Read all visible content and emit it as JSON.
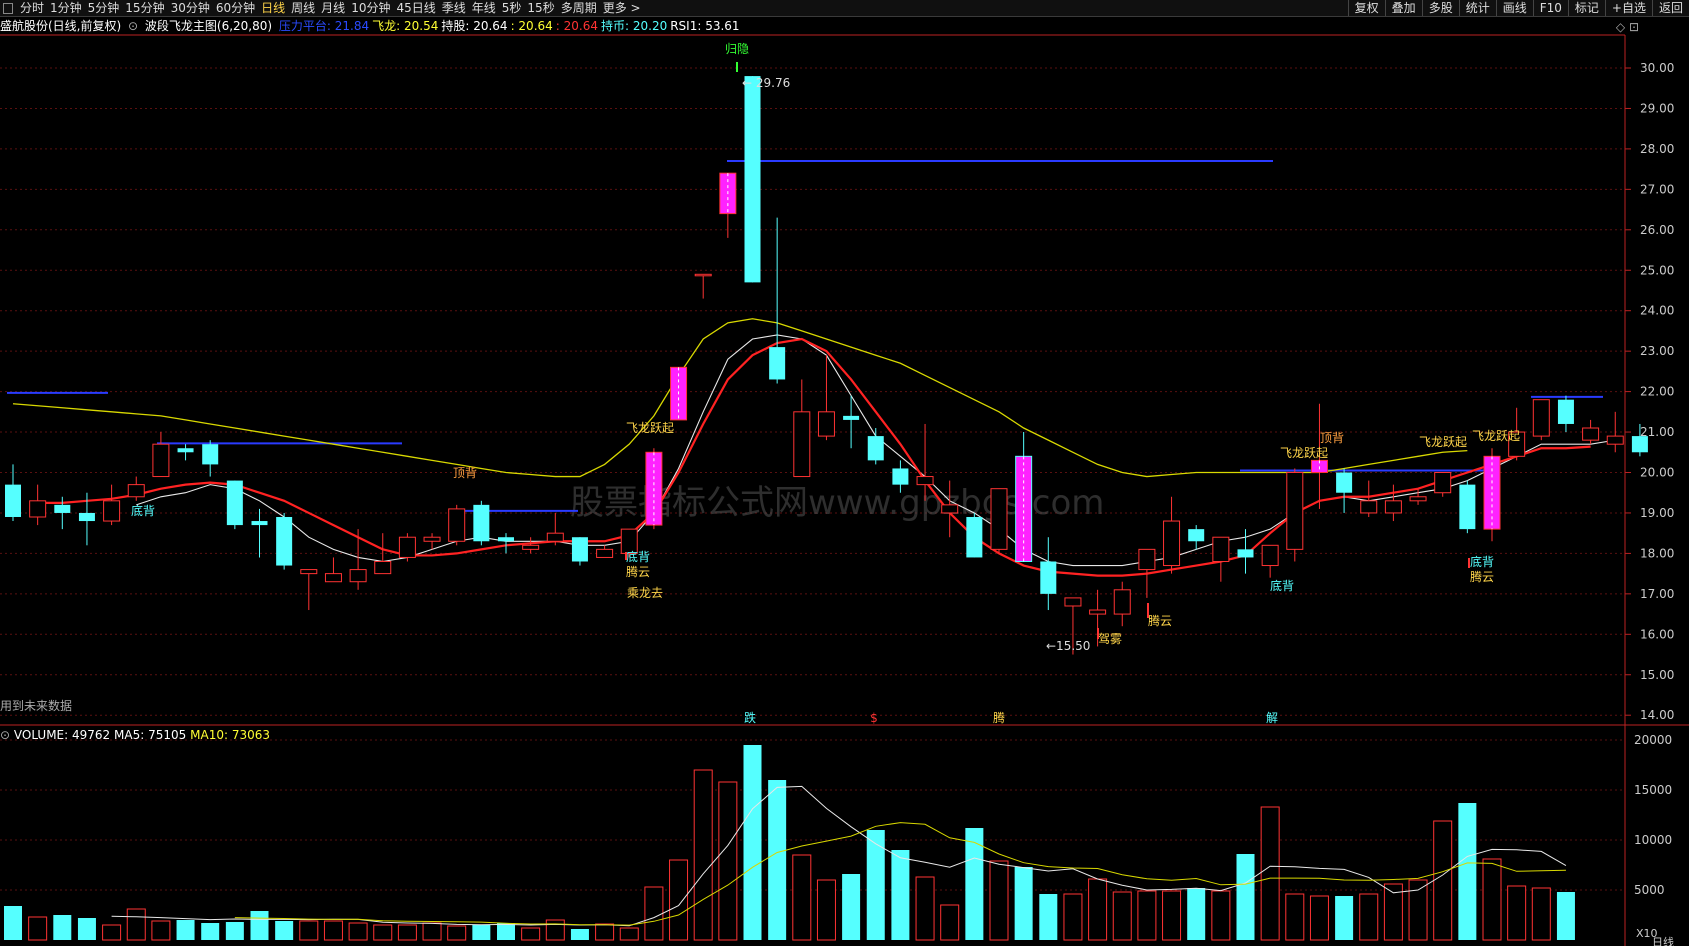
{
  "toolbar": {
    "tabs": [
      "分时",
      "1分钟",
      "5分钟",
      "15分钟",
      "30分钟",
      "60分钟",
      "日线",
      "周线",
      "月线",
      "10分钟",
      "45日线",
      "季线",
      "年线",
      "5秒",
      "15秒",
      "多周期",
      "更多"
    ],
    "active": "日线",
    "right": [
      "复权",
      "叠加",
      "多股",
      "统计",
      "画线",
      "F10",
      "标记",
      "+自选",
      "返回"
    ]
  },
  "info": {
    "stock": "盛航股份(日线,前复权)",
    "indicator": "波段飞龙主图(6,20,80)",
    "items": [
      {
        "label": "压力平台:",
        "value": "21.84",
        "color": "#2a4bff"
      },
      {
        "label": "飞龙:",
        "value": "20.54",
        "color": "#ffff33"
      },
      {
        "label": "持股:",
        "value": "20.64",
        "color": "#ffffff"
      },
      {
        "label": ":",
        "value": "20.64",
        "color": "#ffff33"
      },
      {
        "label": ":",
        "value": "20.64",
        "color": "#ff3333"
      },
      {
        "label": "持币:",
        "value": "20.20",
        "color": "#55ffff"
      },
      {
        "label": "RSI1:",
        "value": "53.61",
        "color": "#ffffff"
      }
    ]
  },
  "price_axis": [
    "30.00",
    "29.00",
    "28.00",
    "27.00",
    "26.00",
    "25.00",
    "24.00",
    "23.00",
    "22.00",
    "21.00",
    "20.00",
    "19.00",
    "18.00",
    "17.00",
    "16.00",
    "15.00",
    "14.00"
  ],
  "vol_axis": [
    "20000",
    "15000",
    "10000",
    "5000"
  ],
  "vol_info": {
    "label": "VOLUME:",
    "value": "49762",
    "ma5_label": "MA5:",
    "ma5": "75105",
    "ma10_label": "MA10:",
    "ma10": "73063"
  },
  "annotations": {
    "high": "29.76",
    "low": "15.50",
    "future": "用到未来数据",
    "watermark": "股票指标公式网www.gpzbgs.com",
    "signals": [
      "底背",
      "顶背",
      "飞龙跃起",
      "底背",
      "腾云",
      "乘龙去",
      "归隐",
      "驾雾",
      "腾云",
      "底背",
      "飞龙跃起",
      "顶背",
      "飞龙跃起",
      "飞龙跃起",
      "底背",
      "腾云"
    ],
    "bottom_marks": [
      "跌",
      "$",
      "腾",
      "解"
    ],
    "x10": "X10",
    "rightbtm": "日线"
  },
  "candles": [
    {
      "o": 19.7,
      "c": 18.9,
      "h": 20.2,
      "l": 18.8
    },
    {
      "o": 18.9,
      "c": 19.3,
      "h": 19.7,
      "l": 18.7
    },
    {
      "o": 19.2,
      "c": 19.0,
      "h": 19.4,
      "l": 18.6
    },
    {
      "o": 19.0,
      "c": 18.8,
      "h": 19.5,
      "l": 18.2
    },
    {
      "o": 18.8,
      "c": 19.3,
      "h": 19.7,
      "l": 18.7
    },
    {
      "o": 19.4,
      "c": 19.7,
      "h": 19.9,
      "l": 19.3
    },
    {
      "o": 19.9,
      "c": 20.7,
      "h": 21.0,
      "l": 19.9
    },
    {
      "o": 20.6,
      "c": 20.5,
      "h": 20.7,
      "l": 20.3
    },
    {
      "o": 20.7,
      "c": 20.2,
      "h": 20.8,
      "l": 19.9
    },
    {
      "o": 19.8,
      "c": 18.7,
      "h": 19.8,
      "l": 18.6
    },
    {
      "o": 18.8,
      "c": 18.7,
      "h": 19.1,
      "l": 17.9
    },
    {
      "o": 18.9,
      "c": 17.7,
      "h": 19.0,
      "l": 17.6
    },
    {
      "o": 17.5,
      "c": 17.6,
      "h": 17.6,
      "l": 16.6
    },
    {
      "o": 17.3,
      "c": 17.5,
      "h": 17.9,
      "l": 17.3
    },
    {
      "o": 17.3,
      "c": 17.6,
      "h": 18.6,
      "l": 17.1
    },
    {
      "o": 17.5,
      "c": 17.8,
      "h": 18.5,
      "l": 17.5
    },
    {
      "o": 17.9,
      "c": 18.4,
      "h": 18.5,
      "l": 17.8
    },
    {
      "o": 18.3,
      "c": 18.4,
      "h": 18.5,
      "l": 18.1
    },
    {
      "o": 18.3,
      "c": 19.1,
      "h": 19.2,
      "l": 18.2
    },
    {
      "o": 19.2,
      "c": 18.3,
      "h": 19.3,
      "l": 18.2
    },
    {
      "o": 18.4,
      "c": 18.3,
      "h": 18.5,
      "l": 18.0
    },
    {
      "o": 18.1,
      "c": 18.2,
      "h": 18.4,
      "l": 18.0
    },
    {
      "o": 18.3,
      "c": 18.5,
      "h": 19.0,
      "l": 18.2
    },
    {
      "o": 18.4,
      "c": 17.8,
      "h": 18.4,
      "l": 17.7
    },
    {
      "o": 17.9,
      "c": 18.1,
      "h": 18.2,
      "l": 17.9
    },
    {
      "o": 18.0,
      "c": 18.6,
      "h": 18.6,
      "l": 17.9
    },
    {
      "o": 18.7,
      "c": 20.5,
      "h": 20.6,
      "l": 18.6
    },
    {
      "o": 21.3,
      "c": 22.6,
      "h": 22.6,
      "l": 21.3
    },
    {
      "o": 24.9,
      "c": 24.9,
      "h": 24.9,
      "l": 24.3
    },
    {
      "o": 26.4,
      "c": 27.4,
      "h": 27.4,
      "l": 25.8
    },
    {
      "o": 29.8,
      "c": 24.7,
      "h": 29.8,
      "l": 24.7
    },
    {
      "o": 23.1,
      "c": 22.3,
      "h": 26.3,
      "l": 22.2
    },
    {
      "o": 19.9,
      "c": 21.5,
      "h": 22.3,
      "l": 19.9
    },
    {
      "o": 20.9,
      "c": 21.5,
      "h": 22.9,
      "l": 20.8
    },
    {
      "o": 21.4,
      "c": 21.3,
      "h": 21.9,
      "l": 20.6
    },
    {
      "o": 20.9,
      "c": 20.3,
      "h": 21.1,
      "l": 20.2
    },
    {
      "o": 20.1,
      "c": 19.7,
      "h": 20.3,
      "l": 19.5
    },
    {
      "o": 19.7,
      "c": 19.9,
      "h": 21.2,
      "l": 19.3
    },
    {
      "o": 19.0,
      "c": 19.2,
      "h": 19.8,
      "l": 18.4
    },
    {
      "o": 18.9,
      "c": 17.9,
      "h": 19.0,
      "l": 17.9
    },
    {
      "o": 18.1,
      "c": 19.6,
      "h": 19.6,
      "l": 18.0
    },
    {
      "o": 20.4,
      "c": 17.8,
      "h": 21.0,
      "l": 17.8
    },
    {
      "o": 17.8,
      "c": 17.0,
      "h": 18.4,
      "l": 16.6
    },
    {
      "o": 16.7,
      "c": 16.9,
      "h": 16.9,
      "l": 15.5
    },
    {
      "o": 16.5,
      "c": 16.6,
      "h": 17.1,
      "l": 15.7
    },
    {
      "o": 16.5,
      "c": 17.1,
      "h": 17.3,
      "l": 16.2
    },
    {
      "o": 17.6,
      "c": 18.1,
      "h": 18.1,
      "l": 16.9
    },
    {
      "o": 17.7,
      "c": 18.8,
      "h": 19.4,
      "l": 17.5
    },
    {
      "o": 18.6,
      "c": 18.3,
      "h": 18.7,
      "l": 18.1
    },
    {
      "o": 17.8,
      "c": 18.4,
      "h": 18.4,
      "l": 17.3
    },
    {
      "o": 18.1,
      "c": 17.9,
      "h": 18.6,
      "l": 17.5
    },
    {
      "o": 17.7,
      "c": 18.2,
      "h": 18.2,
      "l": 17.4
    },
    {
      "o": 18.1,
      "c": 20.0,
      "h": 20.1,
      "l": 17.8
    },
    {
      "o": 20.0,
      "c": 20.3,
      "h": 21.7,
      "l": 19.1
    },
    {
      "o": 20.0,
      "c": 19.5,
      "h": 20.1,
      "l": 19.0
    },
    {
      "o": 19.0,
      "c": 19.3,
      "h": 19.8,
      "l": 18.9
    },
    {
      "o": 19.0,
      "c": 19.3,
      "h": 19.7,
      "l": 18.8
    },
    {
      "o": 19.3,
      "c": 19.4,
      "h": 19.6,
      "l": 19.2
    },
    {
      "o": 19.5,
      "c": 20.0,
      "h": 20.0,
      "l": 19.4
    },
    {
      "o": 19.7,
      "c": 18.6,
      "h": 19.8,
      "l": 18.5
    },
    {
      "o": 18.6,
      "c": 20.4,
      "h": 20.6,
      "l": 18.3
    },
    {
      "o": 20.4,
      "c": 21.0,
      "h": 21.6,
      "l": 20.3
    },
    {
      "o": 20.9,
      "c": 21.8,
      "h": 21.8,
      "l": 20.8
    },
    {
      "o": 21.8,
      "c": 21.2,
      "h": 21.9,
      "l": 21.0
    },
    {
      "o": 20.8,
      "c": 21.1,
      "h": 21.3,
      "l": 20.7
    },
    {
      "o": 20.7,
      "c": 20.9,
      "h": 21.5,
      "l": 20.5
    },
    {
      "o": 20.9,
      "c": 20.5,
      "h": 21.2,
      "l": 20.4
    }
  ],
  "volumes": [
    3400,
    2300,
    2500,
    2200,
    1500,
    3100,
    1900,
    2000,
    1700,
    1800,
    2900,
    1900,
    1900,
    1900,
    1700,
    1500,
    1500,
    1700,
    1400,
    1500,
    1700,
    1200,
    2000,
    1100,
    1600,
    1200,
    5300,
    8000,
    17000,
    15800,
    19500,
    16000,
    8500,
    6000,
    6600,
    11000,
    9000,
    6300,
    3500,
    11200,
    7900,
    7300,
    4600,
    4600,
    6100,
    4800,
    4900,
    4900,
    5200,
    4900,
    8600,
    13300,
    4600,
    4400,
    4400,
    4600,
    5600,
    6000,
    11900,
    13700,
    8100,
    5400,
    5200,
    4800
  ],
  "ma_white": [
    null,
    null,
    null,
    null,
    null,
    19.2,
    19.4,
    19.5,
    19.7,
    19.6,
    19.3,
    18.9,
    18.4,
    18.1,
    17.9,
    17.8,
    17.9,
    18.1,
    18.3,
    18.4,
    18.3,
    18.3,
    18.3,
    18.2,
    18.2,
    18.3,
    19.0,
    20.1,
    21.5,
    22.8,
    23.3,
    23.4,
    23.3,
    22.9,
    21.9,
    20.9,
    20.4,
    19.9,
    19.3,
    19.0,
    18.6,
    18.1,
    17.8,
    17.7,
    17.7,
    17.7,
    17.8,
    17.9,
    18.1,
    18.3,
    18.4,
    18.6,
    19.0,
    19.3,
    19.4,
    19.3,
    19.4,
    19.5,
    19.6,
    19.8,
    20.1,
    20.4,
    20.7,
    20.7,
    20.7,
    20.8
  ],
  "ma_red": [
    null,
    19.25,
    19.25,
    19.3,
    19.35,
    19.45,
    19.6,
    19.7,
    19.75,
    19.7,
    19.5,
    19.3,
    19.0,
    18.7,
    18.4,
    18.1,
    17.95,
    17.95,
    18.0,
    18.1,
    18.2,
    18.25,
    18.3,
    18.3,
    18.3,
    18.45,
    19.0,
    20.0,
    21.2,
    22.3,
    22.9,
    23.2,
    23.3,
    23.0,
    22.3,
    21.5,
    20.7,
    19.8,
    19.0,
    18.4,
    18.0,
    17.7,
    17.55,
    17.5,
    17.45,
    17.45,
    17.5,
    17.6,
    17.7,
    17.8,
    17.95,
    18.5,
    19.0,
    19.3,
    19.4,
    19.4,
    19.5,
    19.6,
    19.8,
    20.0,
    20.2,
    20.4,
    20.6,
    20.6,
    20.64
  ],
  "ma_yellow": [
    21.7,
    21.65,
    21.6,
    21.55,
    21.5,
    21.45,
    21.4,
    21.3,
    21.2,
    21.1,
    21.0,
    20.9,
    20.8,
    20.7,
    20.6,
    20.5,
    20.4,
    20.3,
    20.2,
    20.1,
    20.0,
    19.95,
    19.9,
    19.9,
    20.2,
    20.7,
    21.4,
    22.4,
    23.3,
    23.7,
    23.8,
    23.7,
    23.5,
    23.3,
    23.1,
    22.9,
    22.7,
    22.4,
    22.1,
    21.8,
    21.5,
    21.1,
    20.8,
    20.5,
    20.2,
    20.0,
    19.9,
    19.95,
    20.0,
    20.0,
    20.0,
    20.0,
    20.0,
    20.0,
    20.1,
    20.2,
    20.3,
    20.4,
    20.5,
    20.54
  ]
}
